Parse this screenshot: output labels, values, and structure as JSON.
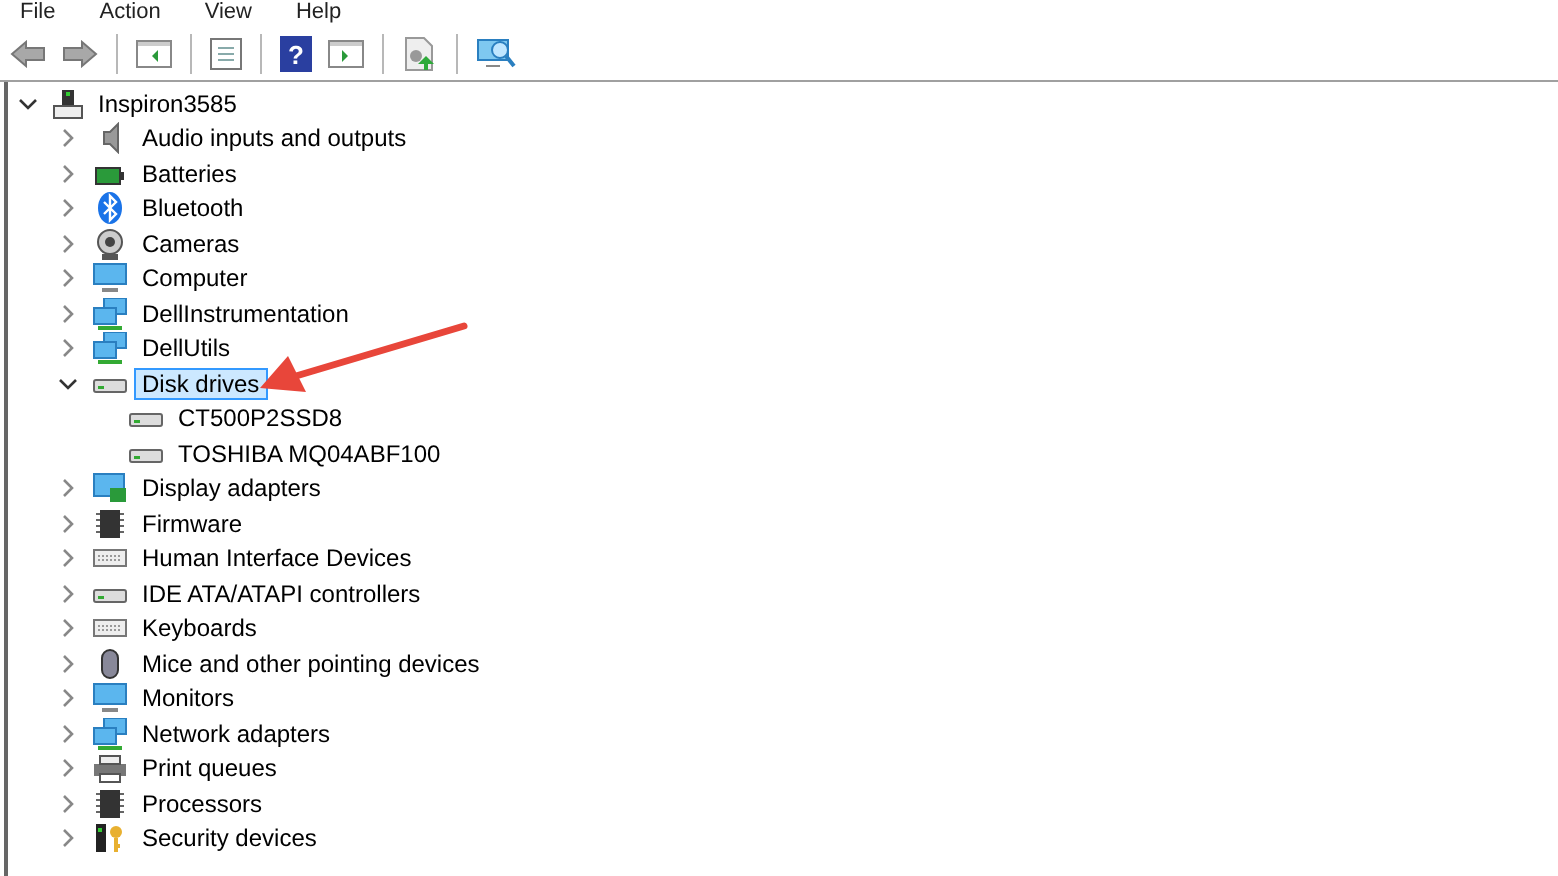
{
  "help_glyph": "?",
  "menu": [
    {
      "label": "File"
    },
    {
      "label": "Action"
    },
    {
      "label": "View"
    },
    {
      "label": "Help"
    }
  ],
  "tree": {
    "label": "Inspiron3585",
    "expanded": true,
    "children": [
      {
        "label": "Audio inputs and outputs",
        "expanded": false,
        "selected": false
      },
      {
        "label": "Batteries",
        "expanded": false,
        "selected": false
      },
      {
        "label": "Bluetooth",
        "expanded": false,
        "selected": false
      },
      {
        "label": "Cameras",
        "expanded": false,
        "selected": false
      },
      {
        "label": "Computer",
        "expanded": false,
        "selected": false
      },
      {
        "label": "DellInstrumentation",
        "expanded": false,
        "selected": false
      },
      {
        "label": "DellUtils",
        "expanded": false,
        "selected": false
      },
      {
        "label": "Disk drives",
        "expanded": true,
        "selected": true,
        "children": [
          {
            "label": "CT500P2SSD8"
          },
          {
            "label": "TOSHIBA MQ04ABF100"
          }
        ]
      },
      {
        "label": "Display adapters",
        "expanded": false,
        "selected": false
      },
      {
        "label": "Firmware",
        "expanded": false,
        "selected": false
      },
      {
        "label": "Human Interface Devices",
        "expanded": false,
        "selected": false
      },
      {
        "label": "IDE ATA/ATAPI controllers",
        "expanded": false,
        "selected": false
      },
      {
        "label": "Keyboards",
        "expanded": false,
        "selected": false
      },
      {
        "label": "Mice and other pointing devices",
        "expanded": false,
        "selected": false
      },
      {
        "label": "Monitors",
        "expanded": false,
        "selected": false
      },
      {
        "label": "Network adapters",
        "expanded": false,
        "selected": false
      },
      {
        "label": "Print queues",
        "expanded": false,
        "selected": false
      },
      {
        "label": "Processors",
        "expanded": false,
        "selected": false
      },
      {
        "label": "Security devices",
        "expanded": false,
        "selected": false
      }
    ]
  }
}
